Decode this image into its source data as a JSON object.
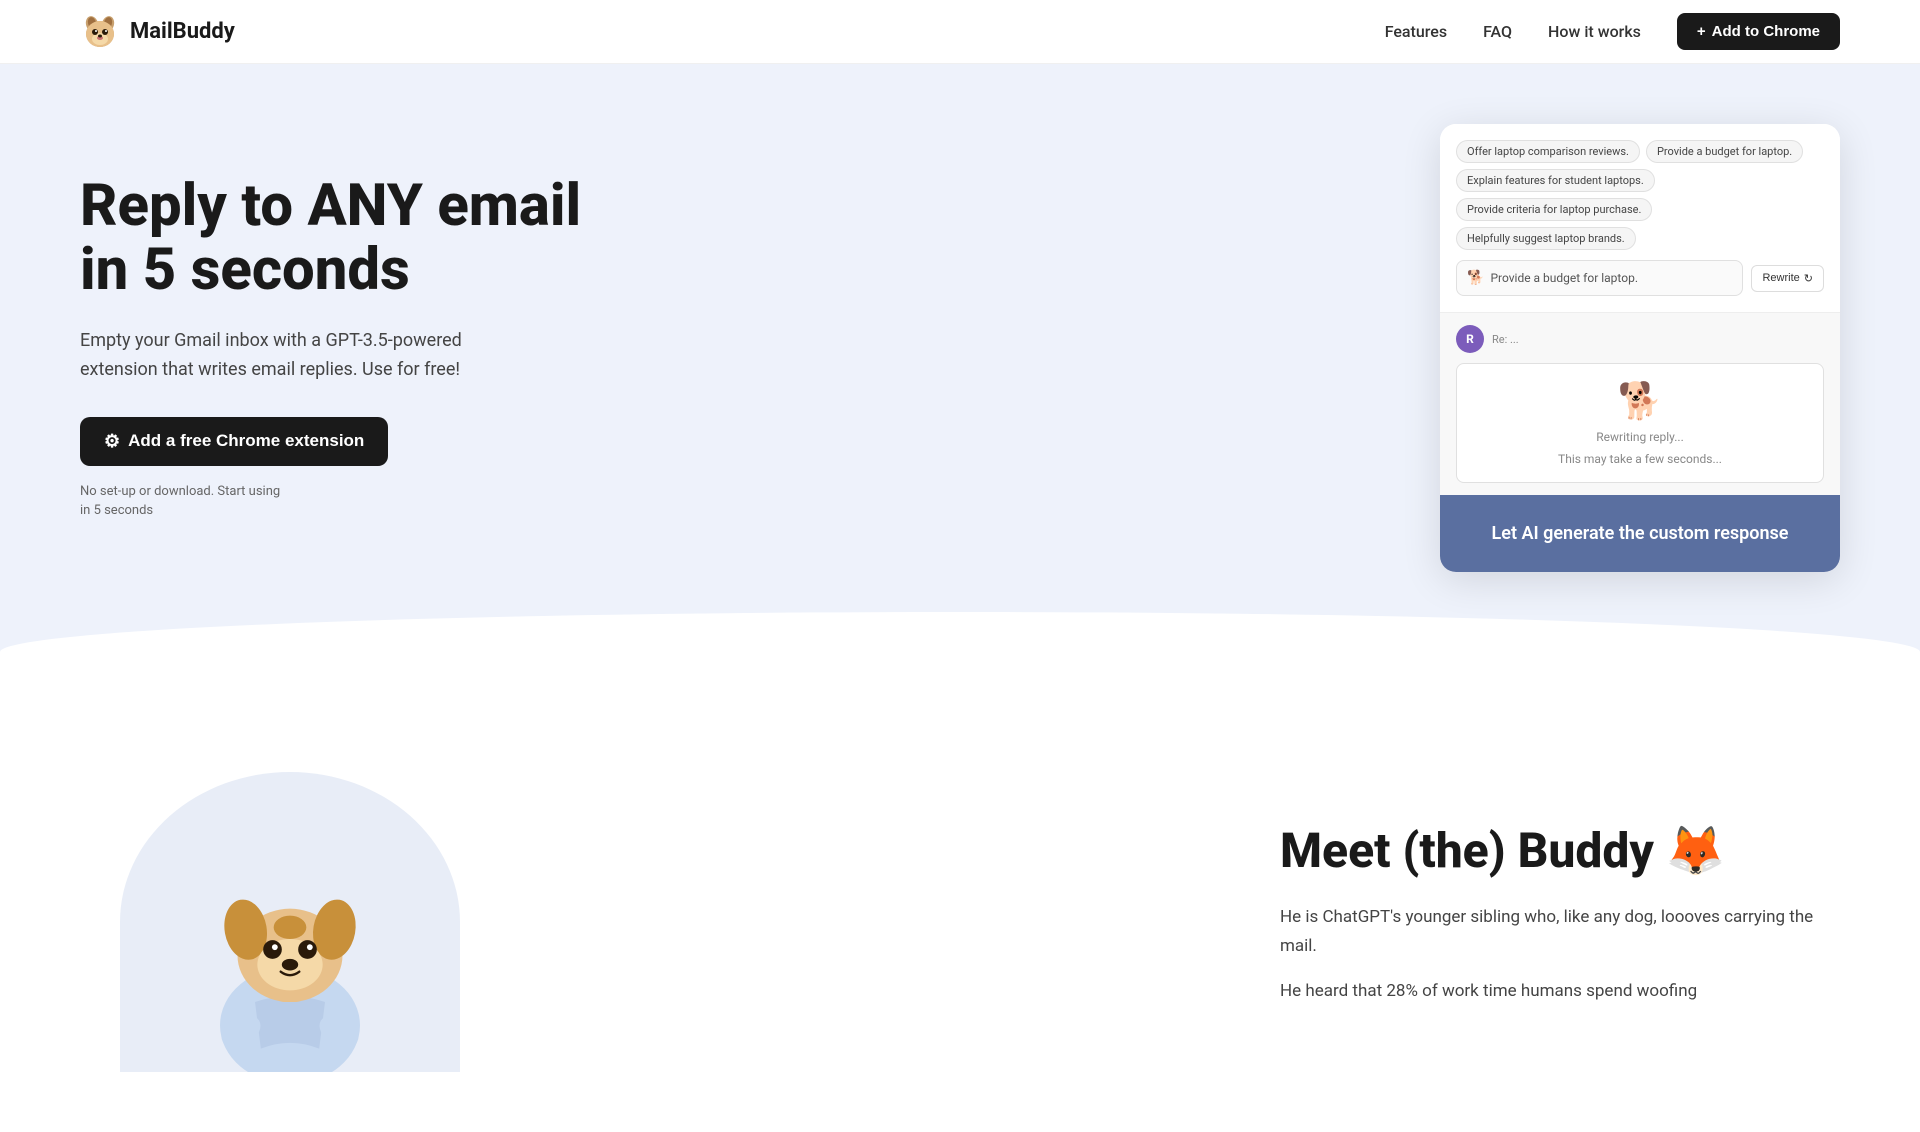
{
  "navbar": {
    "logo_text": "MailBuddy",
    "logo_emoji": "🐕",
    "links": [
      {
        "label": "Features",
        "id": "features"
      },
      {
        "label": "FAQ",
        "id": "faq"
      },
      {
        "label": "How it works",
        "id": "how-it-works"
      }
    ],
    "cta_label": "Add to Chrome",
    "cta_plus": "+"
  },
  "hero": {
    "title_line1": "Reply to ANY email",
    "title_line2": "in 5 seconds",
    "subtitle": "Empty your Gmail inbox with a GPT-3.5-powered extension that writes email replies. Use for free!",
    "cta_label": "Add a free Chrome extension",
    "note_line1": "No set-up or download. Start using",
    "note_line2": "in 5 seconds"
  },
  "screenshot": {
    "chips": [
      "Offer laptop comparison reviews.",
      "Provide a budget for laptop.",
      "Explain features for student laptops.",
      "Provide criteria for laptop purchase.",
      "Helpfully suggest laptop brands."
    ],
    "input_text": "Provide a budget for laptop.",
    "rewrite_label": "Rewrite",
    "avatar_letter": "R",
    "rewriting_label": "Rewriting reply...",
    "rewriting_sub": "This may take a few seconds...",
    "bottom_label": "Let AI generate the custom response"
  },
  "meet": {
    "title": "Meet (the) Buddy 🦊",
    "text1": "He is ChatGPT's younger sibling who, like any dog, loooves carrying the mail.",
    "text2": "He heard that 28% of work time humans spend woofing"
  }
}
